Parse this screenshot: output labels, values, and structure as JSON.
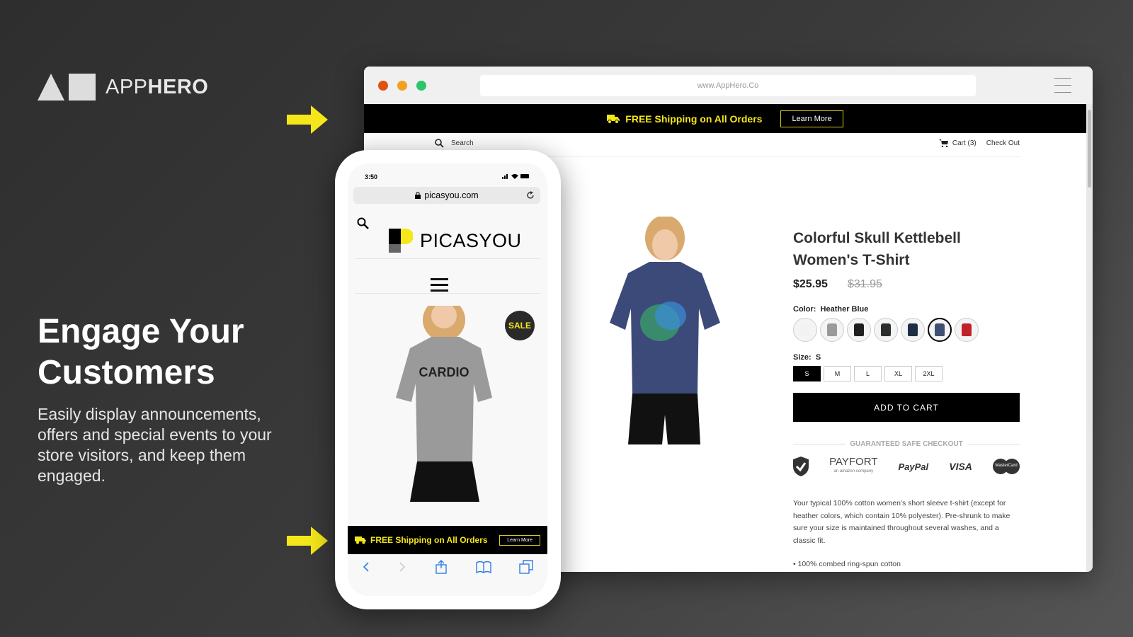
{
  "brand": {
    "prefix": "APP",
    "suffix": "HERO"
  },
  "headline": "Engage Your Customers",
  "paragraph": "Easily display announcements, offers and special events to your store visitors, and keep them engaged.",
  "colors": {
    "accent_yellow": "#f5e71a",
    "banner_bg": "#000000"
  },
  "browser": {
    "url": "www.AppHero.Co",
    "banner": {
      "text": "FREE Shipping on All Orders",
      "button": "Learn More",
      "icon": "truck-icon"
    },
    "nav": {
      "search": "Search",
      "cart": "Cart (3)",
      "checkout": "Check Out"
    },
    "product": {
      "title": "Colorful Skull Kettlebell Women's T-Shirt",
      "price": "$25.95",
      "old_price": "$31.95",
      "color_label": "Color:",
      "color_value": "Heather Blue",
      "swatches": [
        "#f2f2f2",
        "#9a9a9a",
        "#1e1e1e",
        "#2a2f2c",
        "#1f2d45",
        "#3e4f72",
        "#c0222a"
      ],
      "selected_swatch": 5,
      "size_label": "Size:",
      "size_value": "S",
      "sizes": [
        "S",
        "M",
        "L",
        "XL",
        "2XL"
      ],
      "add_to_cart": "ADD TO CART",
      "safe_checkout": "GUARANTEED SAFE CHECKOUT",
      "payment": {
        "payfort": "PAYFORT",
        "payfort_sub": "an amazon company",
        "paypal": "PayPal",
        "visa": "VISA",
        "mastercard": "MasterCard"
      },
      "description": "Your typical 100% cotton women's short sleeve t-shirt (except for heather colors, which contain 10% polyester). Pre-shrunk to make sure your size is maintained throughout several washes, and a classic fit.",
      "bullet": "• 100% combed ring-spun cotton"
    }
  },
  "phone": {
    "time": "3:50",
    "url": "picasyou.com",
    "store": "PICASYOU",
    "sale": "SALE",
    "shirt_text": "CARDIO",
    "banner": {
      "text": "FREE Shipping on All Orders",
      "button": "Learn More"
    }
  }
}
